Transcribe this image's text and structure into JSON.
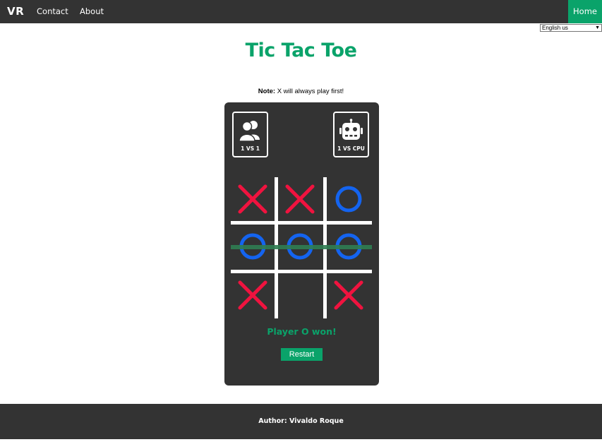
{
  "navbar": {
    "brand": "VR",
    "links": [
      {
        "label": "Contact"
      },
      {
        "label": "About"
      }
    ],
    "home_label": "Home",
    "language_selected": "English us"
  },
  "page": {
    "title": "Tic Tac Toe",
    "note_prefix": "Note:",
    "note_text": " X will always play first!"
  },
  "game": {
    "modes": [
      {
        "label": "1 VS 1",
        "icon": "users-icon"
      },
      {
        "label": "1 VS CPU",
        "icon": "robot-icon"
      }
    ],
    "board": [
      "X",
      "X",
      "O",
      "O",
      "O",
      "O",
      "X",
      "",
      "X"
    ],
    "winning_line": "middle-row",
    "status": "Player O won!",
    "restart_label": "Restart"
  },
  "footer": {
    "author": "Author: Vivaldo Roque"
  },
  "colors": {
    "accent": "#0aa36a",
    "dark": "#333333",
    "x_color": "#f0133f",
    "o_color": "#1464f0",
    "grid": "#ffffff",
    "win_line": "#2f7d52"
  }
}
